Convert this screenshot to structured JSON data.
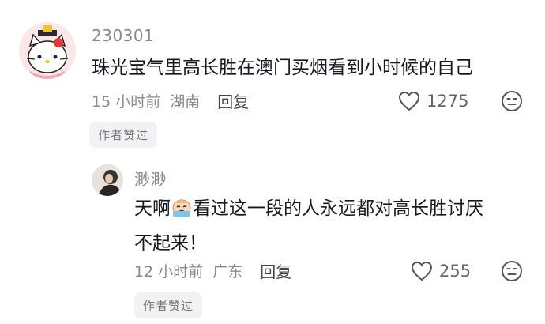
{
  "comments": [
    {
      "username": "230301",
      "text": "珠光宝气里高长胜在澳门买烟看到小时候的自己",
      "time": "15 小时前",
      "location": "湖南",
      "reply_label": "回复",
      "likes": "1275",
      "badge": "作者赞过",
      "avatar_icon": "hello-kitty-avatar"
    },
    {
      "username": "渺渺",
      "text_before_emoji": "天啊",
      "emoji_icon": "crying-face-emoji",
      "text_after_emoji": "看过这一段的人永远都对高长胜讨厌",
      "text_line2": "不起来！",
      "time": "12 小时前",
      "location": "广东",
      "reply_label": "回复",
      "likes": "255",
      "badge": "作者赞过",
      "avatar_icon": "user-photo-avatar"
    }
  ],
  "colors": {
    "text_primary": "#161823",
    "text_secondary": "#8a8a8a",
    "badge_bg": "#f2f2f4"
  }
}
